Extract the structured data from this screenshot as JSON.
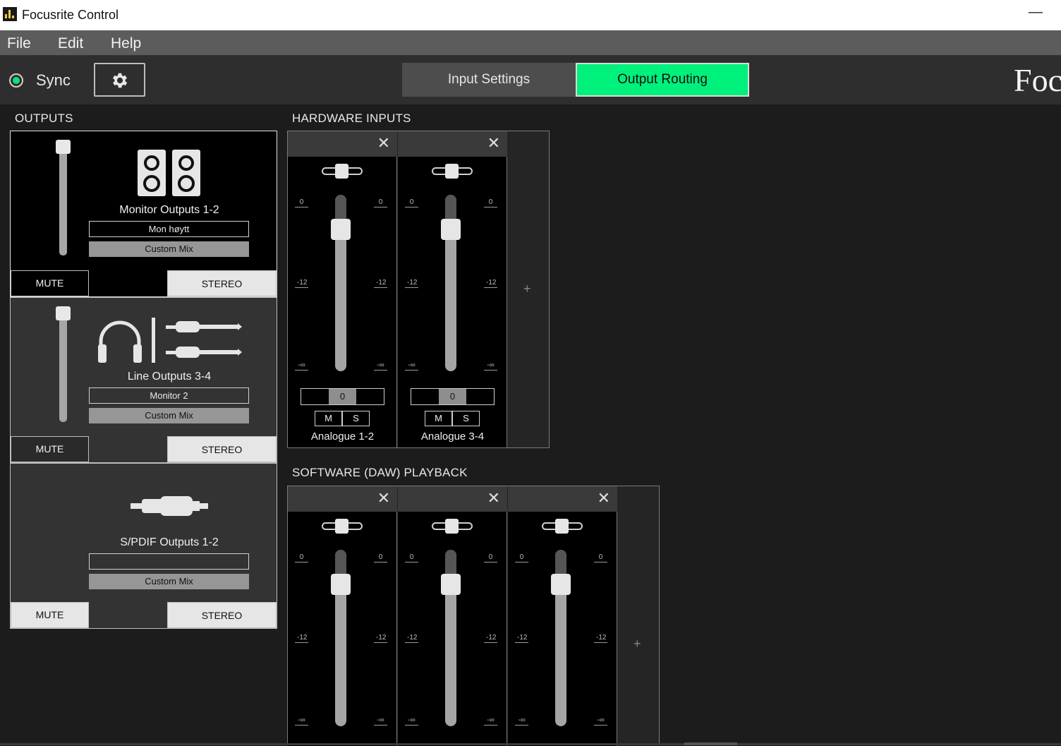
{
  "window": {
    "title": "Focusrite Control",
    "minimize_glyph": "—"
  },
  "menu": {
    "file": "File",
    "edit": "Edit",
    "help": "Help"
  },
  "toolbar": {
    "sync_label": "Sync",
    "sync_status_color": "#10e07a",
    "settings_icon": "gear-icon",
    "tabs": [
      {
        "label": "Input Settings",
        "active": false
      },
      {
        "label": "Output Routing",
        "active": true
      }
    ],
    "accent_color": "#00f07c",
    "brand_text": "Foc"
  },
  "outputs": {
    "heading": "OUTPUTS",
    "cards": [
      {
        "name": "Monitor Outputs 1-2",
        "icon": "speakers-icon",
        "field_value": "Mon høytt",
        "mix_label": "Custom Mix",
        "mute_label": "MUTE",
        "stereo_label": "STEREO",
        "selected": true,
        "level": 1.0
      },
      {
        "name": "Line Outputs 3-4",
        "icon": "headphones-and-jack-icon",
        "field_value": "Monitor 2",
        "mix_label": "Custom Mix",
        "mute_label": "MUTE",
        "stereo_label": "STEREO",
        "selected": false,
        "level": 1.0
      },
      {
        "name": "S/PDIF Outputs 1-2",
        "icon": "spdif-cable-icon",
        "field_value": "",
        "mix_label": "Custom Mix",
        "mute_label": "MUTE",
        "stereo_label": "STEREO",
        "selected": false
      }
    ]
  },
  "hardware_inputs": {
    "heading": "HARDWARE INPUTS",
    "add_label": "+",
    "channels": [
      {
        "name": "Analogue 1-2",
        "gain": "0",
        "mute": "M",
        "solo": "S",
        "scale": [
          "0",
          "-12",
          "-∞"
        ]
      },
      {
        "name": "Analogue 3-4",
        "gain": "0",
        "mute": "M",
        "solo": "S",
        "scale": [
          "0",
          "-12",
          "-∞"
        ]
      }
    ]
  },
  "daw_playback": {
    "heading": "SOFTWARE (DAW) PLAYBACK",
    "add_label": "+",
    "channels": [
      {
        "scale": [
          "0",
          "-12",
          "-∞"
        ]
      },
      {
        "scale": [
          "0",
          "-12",
          "-∞"
        ]
      },
      {
        "scale": [
          "0",
          "-12",
          "-∞"
        ]
      }
    ]
  }
}
